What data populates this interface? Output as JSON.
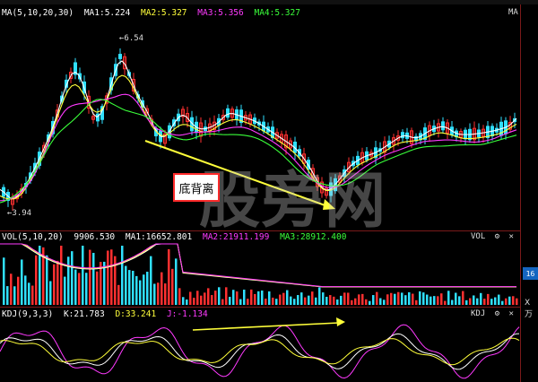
{
  "price_panel": {
    "indicator": "MA(5,10,20,30)",
    "ma1": "MA1:5.224",
    "ma2": "MA2:5.327",
    "ma3": "MA3:5.356",
    "ma4": "MA4:5.327",
    "right_label": "MA",
    "high_label": "6.54",
    "low_label": "3.94",
    "annotation": "底背离",
    "watermark": "股旁网"
  },
  "vol_panel": {
    "indicator": "VOL(5,10,20)",
    "value": "9906.530",
    "ma1": "MA1:16652.801",
    "ma2": "MA2:21911.199",
    "ma3": "MA3:28912.400",
    "name": "VOL",
    "badge": "16",
    "unit": "X万"
  },
  "kdj_panel": {
    "indicator": "KDJ(9,3,3)",
    "k": "K:21.783",
    "d": "D:33.241",
    "j": "J:-1.134",
    "name": "KDJ"
  },
  "controls": {
    "gear": "⚙",
    "close": "✕"
  },
  "colors": {
    "up": "#ff3030",
    "down": "#30e0ff",
    "ma1": "#ffffff",
    "ma2": "#ffff3a",
    "ma3": "#ff3aff",
    "ma4": "#3aff3a"
  }
}
